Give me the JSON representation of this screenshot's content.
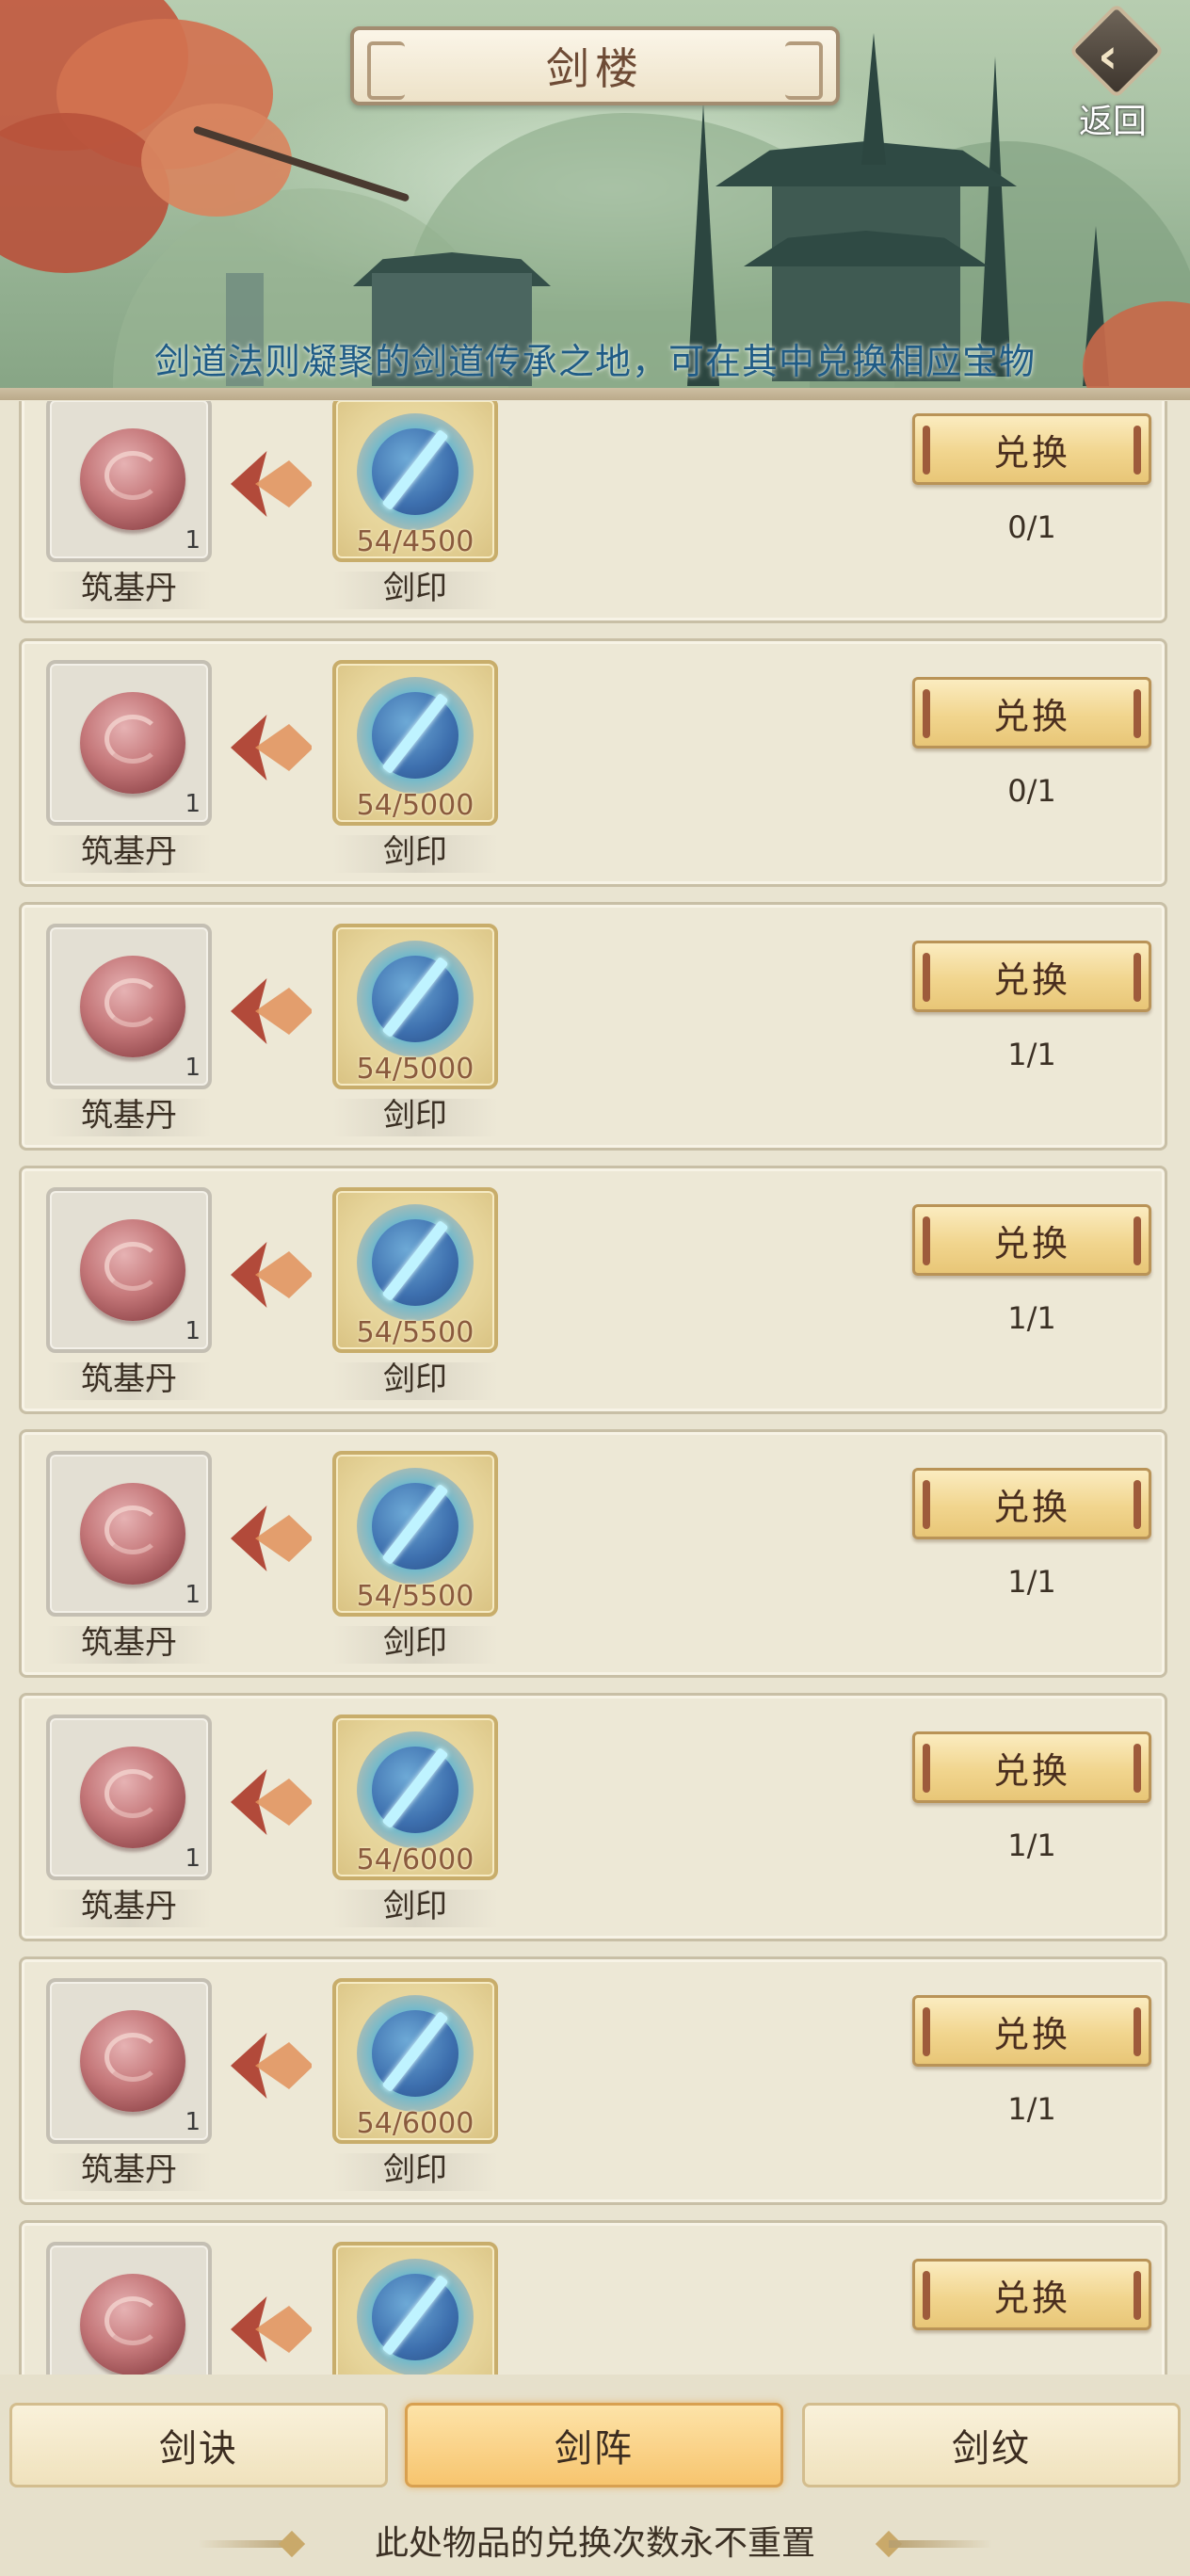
{
  "header": {
    "title": "剑楼",
    "back_label": "返回",
    "subtitle": "剑道法则凝聚的剑道传承之地，可在其中兑换相应宝物"
  },
  "rows": [
    {
      "give_name": "筑基丹",
      "give_qty": "1",
      "cost_name": "剑印",
      "cost_progress": "54/4500",
      "button": "兑换",
      "limit": "0/1"
    },
    {
      "give_name": "筑基丹",
      "give_qty": "1",
      "cost_name": "剑印",
      "cost_progress": "54/5000",
      "button": "兑换",
      "limit": "0/1"
    },
    {
      "give_name": "筑基丹",
      "give_qty": "1",
      "cost_name": "剑印",
      "cost_progress": "54/5000",
      "button": "兑换",
      "limit": "1/1"
    },
    {
      "give_name": "筑基丹",
      "give_qty": "1",
      "cost_name": "剑印",
      "cost_progress": "54/5500",
      "button": "兑换",
      "limit": "1/1"
    },
    {
      "give_name": "筑基丹",
      "give_qty": "1",
      "cost_name": "剑印",
      "cost_progress": "54/5500",
      "button": "兑换",
      "limit": "1/1"
    },
    {
      "give_name": "筑基丹",
      "give_qty": "1",
      "cost_name": "剑印",
      "cost_progress": "54/6000",
      "button": "兑换",
      "limit": "1/1"
    },
    {
      "give_name": "筑基丹",
      "give_qty": "1",
      "cost_name": "剑印",
      "cost_progress": "54/6000",
      "button": "兑换",
      "limit": "1/1"
    },
    {
      "give_name": "",
      "give_qty": "",
      "cost_name": "",
      "cost_progress": "",
      "button": "兑换",
      "limit": ""
    }
  ],
  "tabs": [
    {
      "label": "剑诀",
      "active": false
    },
    {
      "label": "剑阵",
      "active": true
    },
    {
      "label": "剑纹",
      "active": false
    }
  ],
  "footer": {
    "note": "此处物品的兑换次数永不重置"
  },
  "colors": {
    "subtitle": "#1f5b86",
    "active_tab": "#f7c56f",
    "button": "#f1d58e"
  }
}
